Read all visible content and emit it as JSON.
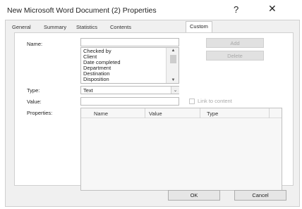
{
  "window": {
    "title": "New Microsoft Word Document (2) Properties",
    "help_glyph": "?",
    "close_glyph": "✕"
  },
  "tabs": [
    {
      "label": "General",
      "active": false
    },
    {
      "label": "Summary",
      "active": false
    },
    {
      "label": "Statistics",
      "active": false
    },
    {
      "label": "Contents",
      "active": false
    },
    {
      "label": "Custom",
      "active": true
    }
  ],
  "custom": {
    "name_label": "Name:",
    "name_value": "",
    "name_options": [
      "Checked by",
      "Client",
      "Date completed",
      "Department",
      "Destination",
      "Disposition"
    ],
    "add_label": "Add",
    "delete_label": "Delete",
    "type_label": "Type:",
    "type_value": "Text",
    "value_label": "Value:",
    "value_value": "",
    "link_label": "Link to content",
    "properties_label": "Properties:",
    "columns": [
      "Name",
      "Value",
      "Type"
    ]
  },
  "footer": {
    "ok_label": "OK",
    "cancel_label": "Cancel"
  }
}
